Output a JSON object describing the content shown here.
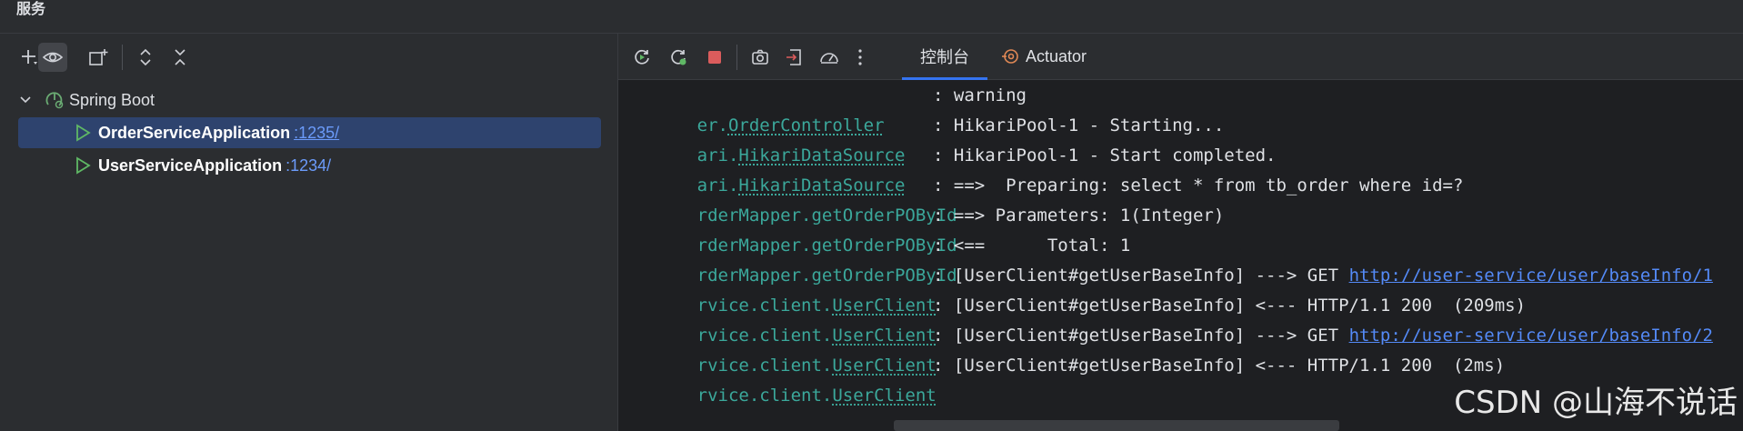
{
  "window": {
    "title": "服务"
  },
  "left_toolbar": {
    "buttons": [
      "add-icon",
      "eye-icon",
      "new-group-icon",
      "expand-all-icon",
      "collapse-all-icon"
    ]
  },
  "tree": {
    "group": {
      "label": "Spring Boot"
    },
    "apps": [
      {
        "name": "OrderServiceApplication",
        "port": ":1235/",
        "selected": true
      },
      {
        "name": "UserServiceApplication",
        "port": ":1234/",
        "selected": false
      }
    ]
  },
  "right_toolbar": {
    "buttons": [
      "rerun-icon",
      "rerun-debug-icon",
      "stop-icon",
      "screenshot-icon",
      "exit-icon",
      "profiler-icon",
      "more-icon"
    ],
    "tabs": [
      {
        "label": "控制台",
        "active": true
      },
      {
        "label": "Actuator",
        "active": false
      }
    ]
  },
  "console": {
    "lines": [
      {
        "prefix": "er.",
        "cls": "OrderController",
        "message": ": warning"
      },
      {
        "prefix": "ari.",
        "cls": "HikariDataSource",
        "message": ": HikariPool-1 - Starting..."
      },
      {
        "prefix": "ari.",
        "cls": "HikariDataSource",
        "message": ": HikariPool-1 - Start completed."
      },
      {
        "prefix": "rderMapper.getOrderPOById",
        "cls": "",
        "message": ": ==>  Preparing: select * from tb_order where id=?"
      },
      {
        "prefix": "rderMapper.getOrderPOById",
        "cls": "",
        "message": ": ==> Parameters: 1(Integer)"
      },
      {
        "prefix": "rderMapper.getOrderPOById",
        "cls": "",
        "message": ": <==      Total: 1"
      },
      {
        "prefix": "rvice.client.",
        "cls": "UserClient",
        "message": ": [UserClient#getUserBaseInfo] ---> GET ",
        "link": "http://user-service/user/baseInfo/1"
      },
      {
        "prefix": "rvice.client.",
        "cls": "UserClient",
        "message": ": [UserClient#getUserBaseInfo] <--- HTTP/1.1 200  (209ms)"
      },
      {
        "prefix": "rvice.client.",
        "cls": "UserClient",
        "message": ": [UserClient#getUserBaseInfo] ---> GET ",
        "link": "http://user-service/user/baseInfo/2"
      },
      {
        "prefix": "rvice.client.",
        "cls": "UserClient",
        "message": ": [UserClient#getUserBaseInfo] <--- HTTP/1.1 200  (2ms)"
      }
    ]
  },
  "watermark": "CSDN @山海不说话",
  "colors": {
    "accent": "#3574f0",
    "logger": "#3ba89b",
    "link": "#548af7",
    "run_green": "#5fb865",
    "stop_red": "#db5c5c"
  }
}
